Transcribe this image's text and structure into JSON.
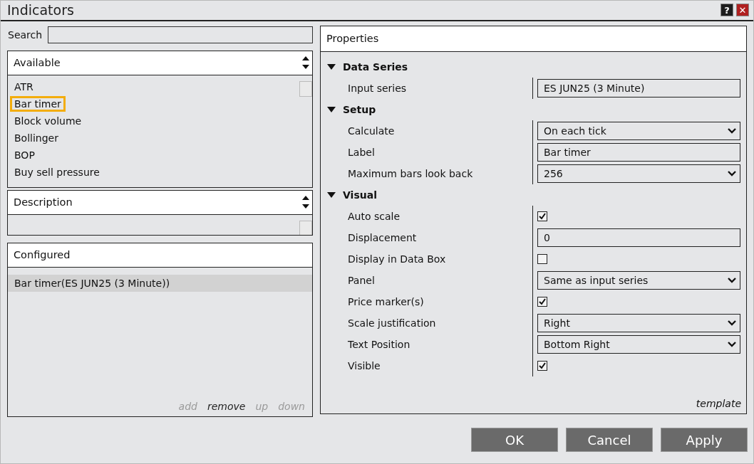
{
  "window": {
    "title": "Indicators",
    "help": "?",
    "close": "✕"
  },
  "search": {
    "label": "Search"
  },
  "available": {
    "title": "Available",
    "items": [
      {
        "label": "ATR",
        "selected": false
      },
      {
        "label": "Bar timer",
        "selected": true
      },
      {
        "label": "Block volume",
        "selected": false
      },
      {
        "label": "Bollinger",
        "selected": false
      },
      {
        "label": "BOP",
        "selected": false
      },
      {
        "label": "Buy sell pressure",
        "selected": false
      }
    ]
  },
  "description": {
    "title": "Description"
  },
  "configured": {
    "title": "Configured",
    "items": [
      {
        "label": "Bar timer(ES JUN25 (3 Minute))",
        "selected": true
      }
    ],
    "actions": [
      {
        "label": "add",
        "disabled": true
      },
      {
        "label": "remove",
        "disabled": false
      },
      {
        "label": "up",
        "disabled": true
      },
      {
        "label": "down",
        "disabled": true
      }
    ]
  },
  "properties": {
    "title": "Properties",
    "groups": [
      {
        "label": "Data Series",
        "expanded": true,
        "rows": [
          {
            "kind": "text",
            "label": "Input series",
            "value": "ES JUN25 (3 Minute)"
          }
        ]
      },
      {
        "label": "Setup",
        "expanded": true,
        "rows": [
          {
            "kind": "select",
            "label": "Calculate",
            "value": "On each tick"
          },
          {
            "kind": "text",
            "label": "Label",
            "value": "Bar timer"
          },
          {
            "kind": "select",
            "label": "Maximum bars look back",
            "value": "256"
          }
        ]
      },
      {
        "label": "Visual",
        "expanded": true,
        "rows": [
          {
            "kind": "checkbox",
            "label": "Auto scale",
            "checked": true
          },
          {
            "kind": "text",
            "label": "Displacement",
            "value": "0"
          },
          {
            "kind": "checkbox",
            "label": "Display in Data Box",
            "checked": false
          },
          {
            "kind": "select",
            "label": "Panel",
            "value": "Same as input series"
          },
          {
            "kind": "checkbox",
            "label": "Price marker(s)",
            "checked": true
          },
          {
            "kind": "select",
            "label": "Scale justification",
            "value": "Right"
          },
          {
            "kind": "select",
            "label": "Text Position",
            "value": "Bottom Right"
          },
          {
            "kind": "checkbox",
            "label": "Visible",
            "checked": true
          }
        ]
      }
    ],
    "template": "template"
  },
  "buttons": [
    "OK",
    "Cancel",
    "Apply"
  ]
}
